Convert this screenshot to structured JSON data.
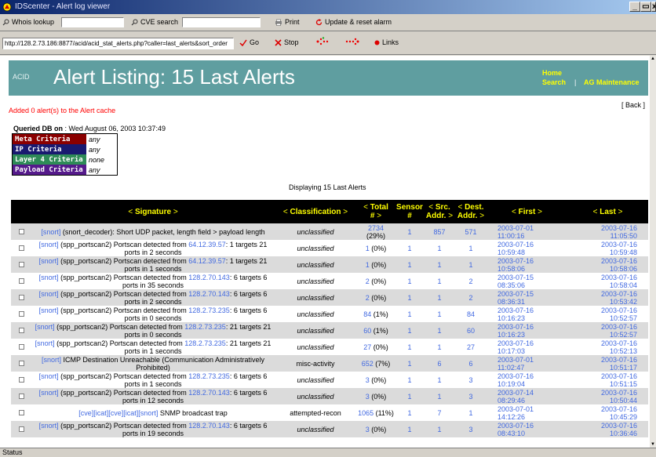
{
  "window": {
    "title": "IDScenter - Alert log viewer"
  },
  "toolbar": {
    "whois_label": "Whois lookup",
    "cve_label": "CVE search",
    "print_label": "Print",
    "update_label": "Update & reset alarm",
    "url": "http://128.2.73.186:8877/acid/acid_stat_alerts.php?caller=last_alerts&sort_order",
    "go_label": "Go",
    "stop_label": "Stop",
    "links_label": "Links"
  },
  "header": {
    "logo": "ACID",
    "title": "Alert Listing: 15 Last Alerts",
    "home": "Home",
    "search": "Search",
    "sep": "|",
    "maintenance": "AG Maintenance",
    "back": "[ Back ]"
  },
  "messages": {
    "added": "Added 0 alert(s) to the Alert cache",
    "queried_label": "Queried DB on",
    "queried_value": " : Wed August 06, 2003 10:37:49",
    "displaying": "Displaying 15 Last Alerts"
  },
  "criteria": [
    {
      "name": "Meta Criteria",
      "value": "any",
      "color": "#8b0000"
    },
    {
      "name": "IP Criteria",
      "value": "any",
      "color": "#191970"
    },
    {
      "name": "Layer 4 Criteria",
      "value": "none",
      "color": "#2e8b57"
    },
    {
      "name": "Payload Criteria",
      "value": "any",
      "color": "#551a8b"
    }
  ],
  "table": {
    "headers": {
      "signature": "Signature",
      "classification": "Classification",
      "total_1": "Total",
      "total_2": "#",
      "sensor_1": "Sensor",
      "sensor_2": "#",
      "src_1": "Src.",
      "src_2": "Addr.",
      "dst_1": "Dest.",
      "dst_2": "Addr.",
      "first": "First",
      "last": "Last",
      "sort_left": "<",
      "sort_right": ">"
    },
    "rows": [
      {
        "tag": "[snort]",
        "text": " (snort_decoder): Short UDP packet, length field > payload length",
        "ip": "",
        "tail": "",
        "cls": "unclassified",
        "cls_italic": true,
        "total": "2734",
        "pct": " (29%)",
        "sensor": "1",
        "src": "857",
        "dst": "571",
        "first": "2003-07-01",
        "first_t": "11:00:16",
        "last": "2003-07-16",
        "last_t": "11:05:50"
      },
      {
        "tag": "[snort]",
        "text": " (spp_portscan2) Portscan detected from ",
        "ip": "64.12.39.57",
        "tail": ": 1 targets 21 ports in 2 seconds",
        "cls": "unclassified",
        "cls_italic": true,
        "total": "1",
        "pct": " (0%)",
        "sensor": "1",
        "src": "1",
        "dst": "1",
        "first": "2003-07-16",
        "first_t": "10:59:48",
        "last": "2003-07-16",
        "last_t": "10:59:48"
      },
      {
        "tag": "[snort]",
        "text": " (spp_portscan2) Portscan detected from ",
        "ip": "64.12.39.57",
        "tail": ": 1 targets 21 ports in 1 seconds",
        "cls": "unclassified",
        "cls_italic": true,
        "total": "1",
        "pct": " (0%)",
        "sensor": "1",
        "src": "1",
        "dst": "1",
        "first": "2003-07-16",
        "first_t": "10:58:06",
        "last": "2003-07-16",
        "last_t": "10:58:06"
      },
      {
        "tag": "[snort]",
        "text": " (spp_portscan2) Portscan detected from ",
        "ip": "128.2.70.143",
        "tail": ": 6 targets 6 ports in 35 seconds",
        "cls": "unclassified",
        "cls_italic": true,
        "total": "2",
        "pct": " (0%)",
        "sensor": "1",
        "src": "1",
        "dst": "2",
        "first": "2003-07-15",
        "first_t": "08:35:06",
        "last": "2003-07-16",
        "last_t": "10:58:04"
      },
      {
        "tag": "[snort]",
        "text": " (spp_portscan2) Portscan detected from ",
        "ip": "128.2.70.143",
        "tail": ": 6 targets 6 ports in 2 seconds",
        "cls": "unclassified",
        "cls_italic": true,
        "total": "2",
        "pct": " (0%)",
        "sensor": "1",
        "src": "1",
        "dst": "2",
        "first": "2003-07-15",
        "first_t": "08:36:31",
        "last": "2003-07-16",
        "last_t": "10:53:42"
      },
      {
        "tag": "[snort]",
        "text": " (spp_portscan2) Portscan detected from ",
        "ip": "128.2.73.235",
        "tail": ": 6 targets 6 ports in 0 seconds",
        "cls": "unclassified",
        "cls_italic": true,
        "total": "84",
        "pct": " (1%)",
        "sensor": "1",
        "src": "1",
        "dst": "84",
        "first": "2003-07-16",
        "first_t": "10:16:23",
        "last": "2003-07-16",
        "last_t": "10:52:57"
      },
      {
        "tag": "[snort]",
        "text": " (spp_portscan2) Portscan detected from ",
        "ip": "128.2.73.235",
        "tail": ": 21 targets 21 ports in 0 seconds",
        "cls": "unclassified",
        "cls_italic": true,
        "total": "60",
        "pct": " (1%)",
        "sensor": "1",
        "src": "1",
        "dst": "60",
        "first": "2003-07-16",
        "first_t": "10:16:23",
        "last": "2003-07-16",
        "last_t": "10:52:57"
      },
      {
        "tag": "[snort]",
        "text": " (spp_portscan2) Portscan detected from ",
        "ip": "128.2.73.235",
        "tail": ": 21 targets 21 ports in 1 seconds",
        "cls": "unclassified",
        "cls_italic": true,
        "total": "27",
        "pct": " (0%)",
        "sensor": "1",
        "src": "1",
        "dst": "27",
        "first": "2003-07-16",
        "first_t": "10:17:03",
        "last": "2003-07-16",
        "last_t": "10:52:13"
      },
      {
        "tag": "[snort]",
        "text": " ICMP Destination Unreachable (Communication Administratively Prohibited)",
        "ip": "",
        "tail": "",
        "cls": "misc-activity",
        "cls_italic": false,
        "total": "652",
        "pct": " (7%)",
        "sensor": "1",
        "src": "6",
        "dst": "6",
        "first": "2003-07-01",
        "first_t": "11:02:47",
        "last": "2003-07-16",
        "last_t": "10:51:17"
      },
      {
        "tag": "[snort]",
        "text": " (spp_portscan2) Portscan detected from ",
        "ip": "128.2.73.235",
        "tail": ": 6 targets 6 ports in 1 seconds",
        "cls": "unclassified",
        "cls_italic": true,
        "total": "3",
        "pct": " (0%)",
        "sensor": "1",
        "src": "1",
        "dst": "3",
        "first": "2003-07-16",
        "first_t": "10:19:04",
        "last": "2003-07-16",
        "last_t": "10:51:15"
      },
      {
        "tag": "[snort]",
        "text": " (spp_portscan2) Portscan detected from ",
        "ip": "128.2.70.143",
        "tail": ": 6 targets 6 ports in 12 seconds",
        "cls": "unclassified",
        "cls_italic": true,
        "total": "3",
        "pct": " (0%)",
        "sensor": "1",
        "src": "1",
        "dst": "3",
        "first": "2003-07-14",
        "first_t": "08:29:46",
        "last": "2003-07-16",
        "last_t": "10:50:44"
      },
      {
        "tag": "[cve][icat][cve][icat][snort]",
        "text": " SNMP broadcast trap",
        "ip": "",
        "tail": "",
        "cls": "attempted-recon",
        "cls_italic": false,
        "total": "1065",
        "pct": " (11%)",
        "sensor": "1",
        "src": "7",
        "dst": "1",
        "first": "2003-07-01",
        "first_t": "14:12:26",
        "last": "2003-07-16",
        "last_t": "10:45:29"
      },
      {
        "tag": "[snort]",
        "text": " (spp_portscan2) Portscan detected from ",
        "ip": "128.2.70.143",
        "tail": ": 6 targets 6 ports in 19 seconds",
        "cls": "unclassified",
        "cls_italic": true,
        "total": "3",
        "pct": " (0%)",
        "sensor": "1",
        "src": "1",
        "dst": "3",
        "first": "2003-07-16",
        "first_t": "08:43:10",
        "last": "2003-07-16",
        "last_t": "10:36:46"
      }
    ]
  },
  "statusbar": {
    "text": "Status"
  }
}
